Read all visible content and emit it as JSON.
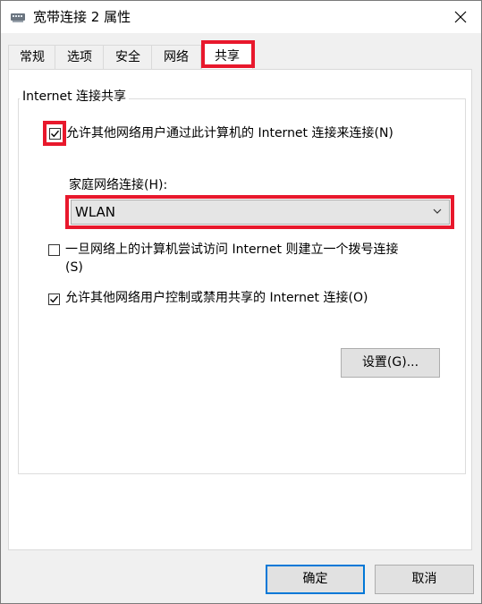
{
  "window": {
    "title": "宽带连接 2 属性",
    "icon": "network-adapter-icon"
  },
  "tabs": [
    {
      "label": "常规"
    },
    {
      "label": "选项"
    },
    {
      "label": "安全"
    },
    {
      "label": "网络"
    },
    {
      "label": "共享",
      "active": true
    }
  ],
  "sharing": {
    "group_title": "Internet 连接共享",
    "allow_share": {
      "label": "允许其他网络用户通过此计算机的 Internet 连接来连接(N)",
      "checked": true
    },
    "home_network": {
      "label": "家庭网络连接(H):",
      "value": "WLAN"
    },
    "dial_on_demand": {
      "label_line1": "一旦网络上的计算机尝试访问 Internet 则建立一个拨号连接",
      "label_line2": "(S)",
      "checked": false
    },
    "allow_control": {
      "label": "允许其他网络用户控制或禁用共享的 Internet 连接(O)",
      "checked": true
    },
    "settings_button": "设置(G)..."
  },
  "footer": {
    "ok": "确定",
    "cancel": "取消"
  },
  "colors": {
    "highlight": "#e8182c",
    "accent": "#0078d7"
  }
}
